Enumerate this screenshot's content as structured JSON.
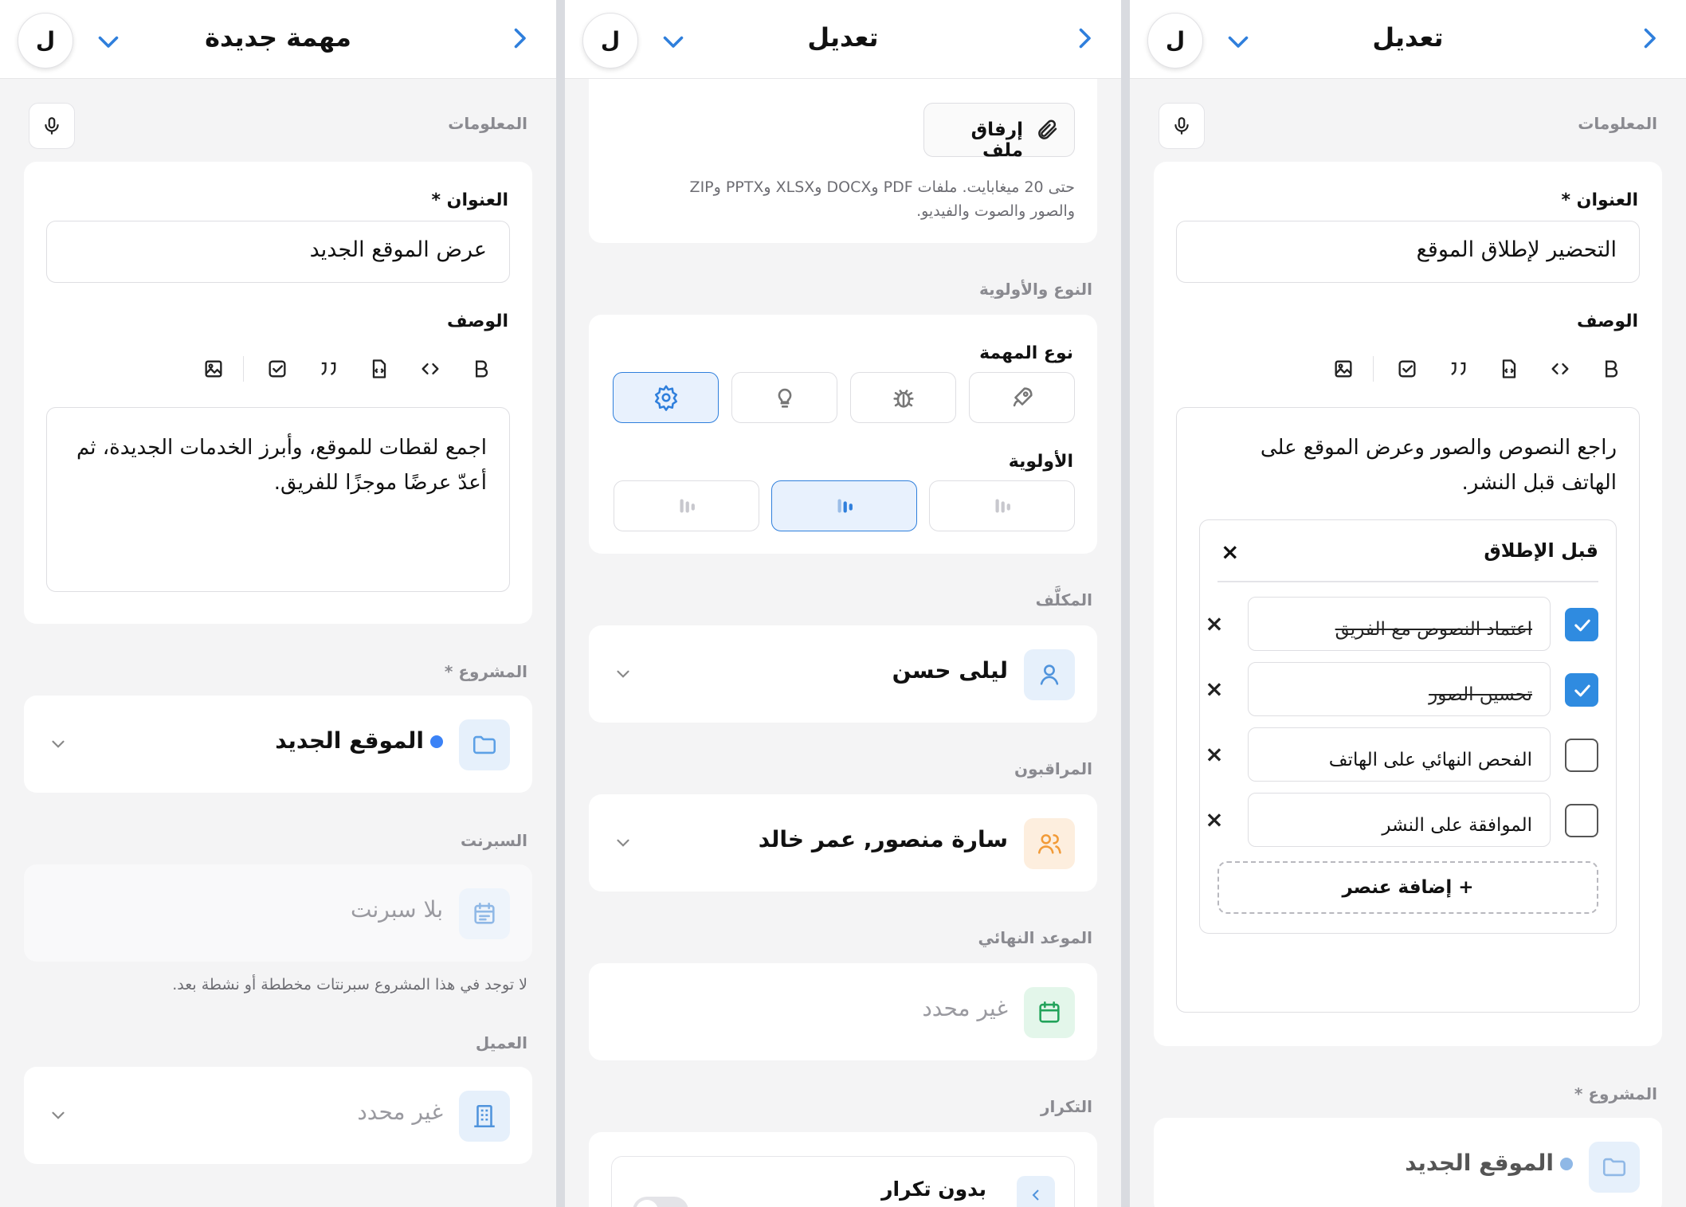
{
  "panel1": {
    "title": "مهمة جديدة",
    "avatar": "ل",
    "section_info": "المعلومات",
    "title_label": "العنوان *",
    "title_value": "عرض الموقع الجديد",
    "desc_label": "الوصف",
    "desc_value": "اجمع لقطات للموقع، وأبرز الخدمات الجديدة، ثم أعدّ عرضًا موجزًا للفريق.",
    "project_label": "المشروع *",
    "project_value": "الموقع الجديد",
    "sprint_label": "السبرنت",
    "sprint_value": "بلا سبرنت",
    "sprint_helper": "لا توجد في هذا المشروع سبرنتات مخططة أو نشطة بعد.",
    "client_label": "العميل",
    "client_value": "غير محدد"
  },
  "panel2": {
    "title": "تعديل",
    "avatar": "ل",
    "attach_label": "إرفاق ملف",
    "attach_helper_1": "حتى 20 ميغابايت. ملفات PDF وDOCX وXLSX وPPTX وZIP",
    "attach_helper_2": "والصور والصوت والفيديو.",
    "section_type": "النوع والأولوية",
    "task_type_label": "نوع المهمة",
    "priority_label": "الأولوية",
    "assignee_label": "المكلَّف",
    "assignee_value": "ليلى حسن",
    "watchers_label": "المراقبون",
    "watchers_value": "سارة منصور, عمر خالد",
    "due_label": "الموعد النهائي",
    "due_value": "غير محدد",
    "repeat_label": "التكرار",
    "repeat_value": "بدون تكرار"
  },
  "panel3": {
    "title": "تعديل",
    "avatar": "ل",
    "section_info": "المعلومات",
    "title_label": "العنوان *",
    "title_value": "التحضير لإطلاق الموقع",
    "desc_label": "الوصف",
    "desc_value": "راجع النصوص والصور وعرض الموقع على الهاتف قبل النشر.",
    "checklist_title": "قبل الإطلاق",
    "checklist": [
      {
        "text": "اعتماد النصوص مع الفريق",
        "done": true
      },
      {
        "text": "تحسين الصور",
        "done": true
      },
      {
        "text": "الفحص النهائي على الهاتف",
        "done": false
      },
      {
        "text": "الموافقة على النشر",
        "done": false
      }
    ],
    "add_item": "+ إضافة عنصر",
    "project_label": "المشروع *",
    "project_value": "الموقع الجديد"
  },
  "colors": {
    "accent": "#2f7fdc",
    "folder_bg": "#e6f0fb",
    "user_bg": "#e6f0fb",
    "watchers_bg": "#fdeede",
    "calendar_bg": "#e3f6ea",
    "calendar_green": "#22a35a",
    "watchers_orange": "#f29b38"
  }
}
